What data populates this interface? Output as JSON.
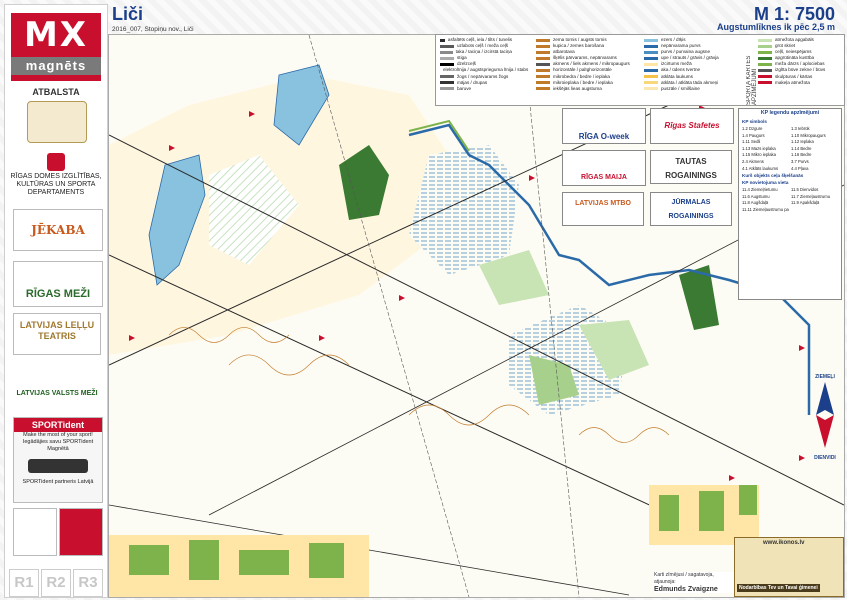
{
  "sidebar": {
    "logo_mark": "MX",
    "logo_text": "magnēts",
    "support_label": "ATBALSTA",
    "dept_text": "RĪGAS DOMES IZGLĪTĪBAS, KULTŪRAS UN SPORTA DEPARTAMENTS",
    "sponsor_jekaba": "JĒKABA ajutrica",
    "sponsor_rigas_mezi": "RĪGAS MEŽI",
    "sponsor_lellu": "LATVIJAS LEĻĻU TEATRIS",
    "sponsor_valsts": "LATVIJAS VALSTS MEŽI",
    "sportident_title": "SPORTident",
    "sportident_slogan": "Make the most of your sport!",
    "sportident_note": "Iegādājies savu SPORTident Magnētā",
    "sportident_partner": "SPORTident partneris Latvijā",
    "r_labels": [
      "R1",
      "R2",
      "R3"
    ]
  },
  "header": {
    "title": "Liči",
    "strip": "2016_007, Stopiņu nov., Liči",
    "scale": "M 1: 7500",
    "contour": "Augstumlīknes ik pēc 2,5 m"
  },
  "legend": {
    "side_title": "SPORTA KARTES APZĪMĒJUMI",
    "col1": [
      "asfaltēts ceļš, iela / tilts / tunelis",
      "uzlabots ceļš / meža ceļš",
      "taka / taciņa / izcirstā taciņa",
      "stiga",
      "dzelzceļš",
      "elektrolīnija / augstsprieguma līnija / stabs",
      "žogs / nepārvarams žogs",
      "mājas / drupas",
      "baruve"
    ],
    "col2": [
      "zema tornis / augsts tornis",
      "kupica / zemes barošana",
      "atbarotava",
      "šķēlis pārvarams, nepārvarams",
      "akmens / liels akmens / mikropaugurs",
      "horizontāle / palīghorizontāle",
      "mikrobedra / bedre / ieplaka",
      "mikroieplaka / bedre / ieplaka",
      "iekšējās lieas augstuma"
    ],
    "col3": [
      "ezers / dīķis",
      "nepārvarama purvs",
      "purvs / purvaina augsne",
      "upe / strauts / grāvis / grāvja",
      "izcirtums mežā",
      "aka / ūdens tvertne",
      "atklāta laukums",
      "atklāta / atklāta tāda akmeņi",
      "puszāle / smilšaine"
    ],
    "col4": [
      "atmežota apgabāls",
      "grūt skriet",
      "ceļš, neiespējams",
      "apgrūtināta kustība",
      "meža dārzs / aplociebas",
      "izglīta būve zekne / būvs",
      "skulpturas / kārtas",
      "makeļa atmežota"
    ]
  },
  "events": [
    "RĪGA O-week",
    "Rīgas Stafetes",
    "RĪGAS MAIJA",
    "TAUTAS ROGAININGS",
    "LATVIJAS MTBO",
    "JŪRMALAS ROGAININGS"
  ],
  "kp": {
    "title": "KP legendu apzīmējumi",
    "sec1": "KP simbols",
    "items1": [
      "1.2 Dzgure",
      "1.3 Iebrūk",
      "1.4 Paugurs",
      "1.10 Mikropaugurs",
      "1.11 Sedli",
      "1.12 Ieplaka",
      "1.13 Mazs ieplaka",
      "1.14 Bedre",
      "1.15 Mikro ieplaka",
      "1.16 Bedre",
      "2.4 Akmens",
      "3.7 Purvs",
      "4.1 Atklāts laukums",
      "4.4 Pļava"
    ],
    "sec2": "Kurš objekts ceļa šķelšanās",
    "sec3": "KP novietojuma vieta",
    "items3": [
      "11.4 Ziemeļrietumu",
      "11.5 Dienvidos",
      "11.6 Augstumu",
      "11.7 Ziemeļaustrumu",
      "11.8 Augšdaļā",
      "11.9 Apakšdaļā",
      "11.11 Ziemeļaustrumu pakājā"
    ]
  },
  "north": {
    "top": "ZIEMEĻI",
    "bottom": "DIENVIDI"
  },
  "cartographer": {
    "label": "Karti zīmējusi / sagatavoja, atjaunoja:",
    "name": "Edmunds Zvaigzne"
  },
  "ad": {
    "url": "www.ikonos.lv",
    "text": "Nodarbības Tev un Tavai ģimenei"
  },
  "colors": {
    "brand": "#c8102e",
    "title_blue": "#1b3f8a",
    "forest_green": "#7eb34b",
    "water": "#89c2df",
    "road": "#2a2a2a"
  }
}
